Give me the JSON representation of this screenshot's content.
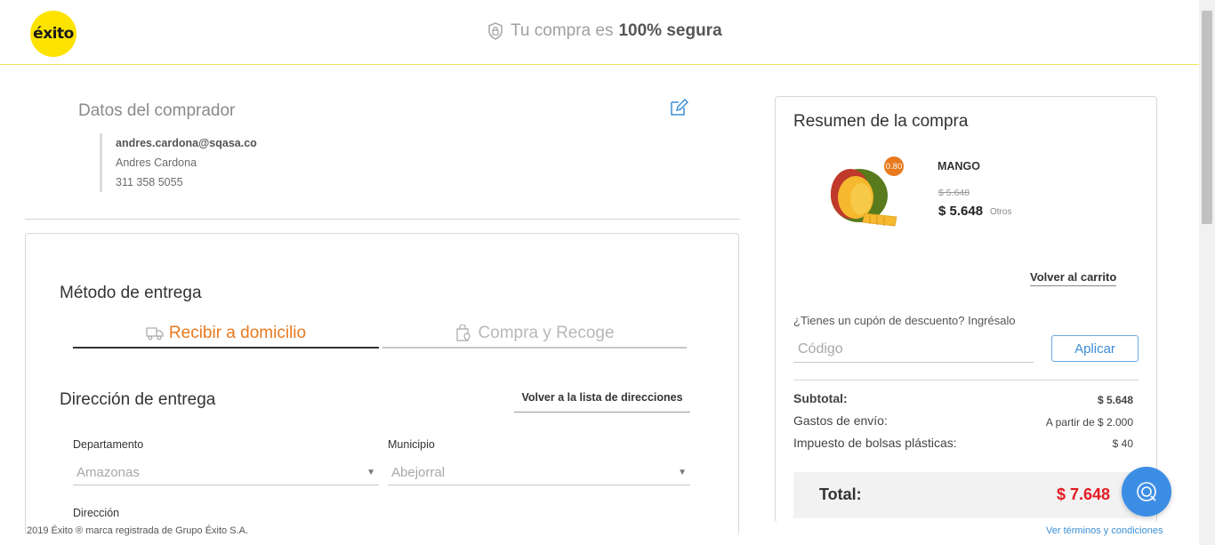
{
  "header": {
    "logo_text": "éxito",
    "secure_text": "Tu compra es",
    "secure_bold": "100% segura"
  },
  "buyer": {
    "title": "Datos del comprador",
    "email": "andres.cardona@sqasa.co",
    "name": "Andres Cardona",
    "phone": "311 358 5055"
  },
  "delivery": {
    "title": "Método de entrega",
    "tabs": [
      {
        "label": "Recibir a domicilio",
        "active": true
      },
      {
        "label": "Compra y Recoge",
        "active": false
      }
    ],
    "address_title": "Dirección de entrega",
    "back_list_label": "Volver a la lista de direcciones",
    "department_label": "Departamento",
    "department_value": "Amazonas",
    "municipality_label": "Municipio",
    "municipality_value": "Abejorral",
    "address_label": "Dirección"
  },
  "summary": {
    "title": "Resumen de la compra",
    "product": {
      "name": "MANGO",
      "badge": "0.80",
      "old_price": "$ 5.648",
      "price": "$ 5.648",
      "seller": "Otros"
    },
    "back_cart_label": "Volver al carrito",
    "coupon_question": "¿Tienes un cupón de descuento? Ingrésalo",
    "coupon_placeholder": "Código",
    "apply_label": "Aplicar",
    "subtotal_label": "Subtotal:",
    "subtotal_value": "$ 5.648",
    "shipping_label": "Gastos de envío:",
    "shipping_value": "A partir de $ 2.000",
    "bag_tax_label": "Impuesto de bolsas plásticas:",
    "bag_tax_value": "$ 40",
    "total_label": "Total:",
    "total_value": "$ 7.648"
  },
  "footer": {
    "copyright": "2019 Éxito ® marca registrada de Grupo Éxito S.A.",
    "terms_link": "Ver términos y condiciones"
  },
  "colors": {
    "accent_orange": "#e8791d",
    "link_blue": "#3c8ed6",
    "total_red": "#e31b23",
    "brand_yellow": "#fde300"
  }
}
